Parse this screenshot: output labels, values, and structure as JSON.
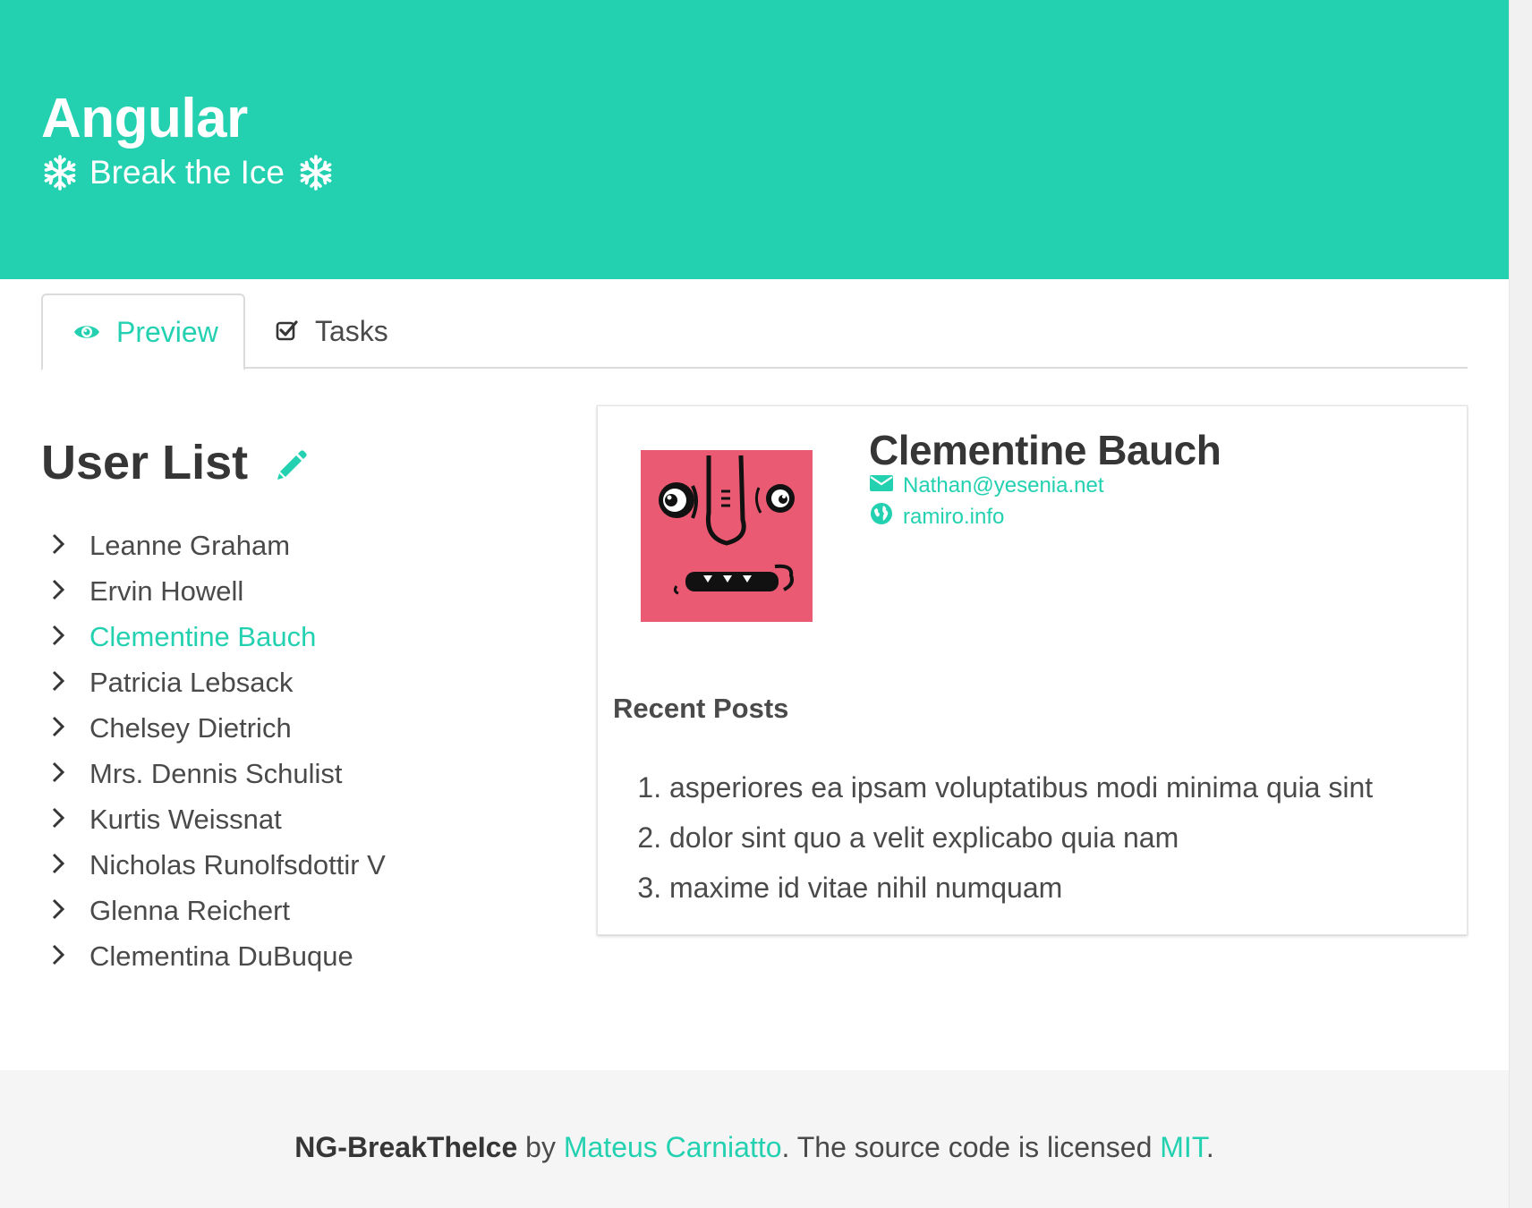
{
  "hero": {
    "title": "Angular",
    "subtitle": "Break the Ice",
    "left_icon": "snowflake-icon",
    "right_icon": "snowflake-icon",
    "background": "#23d1b1"
  },
  "tabs": [
    {
      "label": "Preview",
      "icon": "eye-icon",
      "active": true
    },
    {
      "label": "Tasks",
      "icon": "checkbox-icon",
      "active": false
    }
  ],
  "user_list": {
    "title": "User List",
    "edit_icon": "pencil-icon",
    "users": [
      "Leanne Graham",
      "Ervin Howell",
      "Clementine Bauch",
      "Patricia Lebsack",
      "Chelsey Dietrich",
      "Mrs. Dennis Schulist",
      "Kurtis Weissnat",
      "Nicholas Runolfsdottir V",
      "Glenna Reichert",
      "Clementina DuBuque"
    ],
    "selected": "Clementine Bauch"
  },
  "profile": {
    "name": "Clementine Bauch",
    "email": "Nathan@yesenia.net",
    "website": "ramiro.info",
    "avatar_color": "#eb5a73",
    "recent_posts_title": "Recent Posts",
    "posts": [
      "asperiores ea ipsam voluptatibus modi minima quia sint",
      "dolor sint quo a velit explicabo quia nam",
      "maxime id vitae nihil numquam"
    ]
  },
  "footer": {
    "project": "NG-BreakTheIce",
    "by": "by",
    "author": "Mateus Carniatto",
    "license_text": ". The source code is licensed",
    "license": "MIT",
    "end": "."
  },
  "colors": {
    "accent": "#23d1b1",
    "text": "#4a4a4a",
    "footer_bg": "#f5f5f5"
  }
}
